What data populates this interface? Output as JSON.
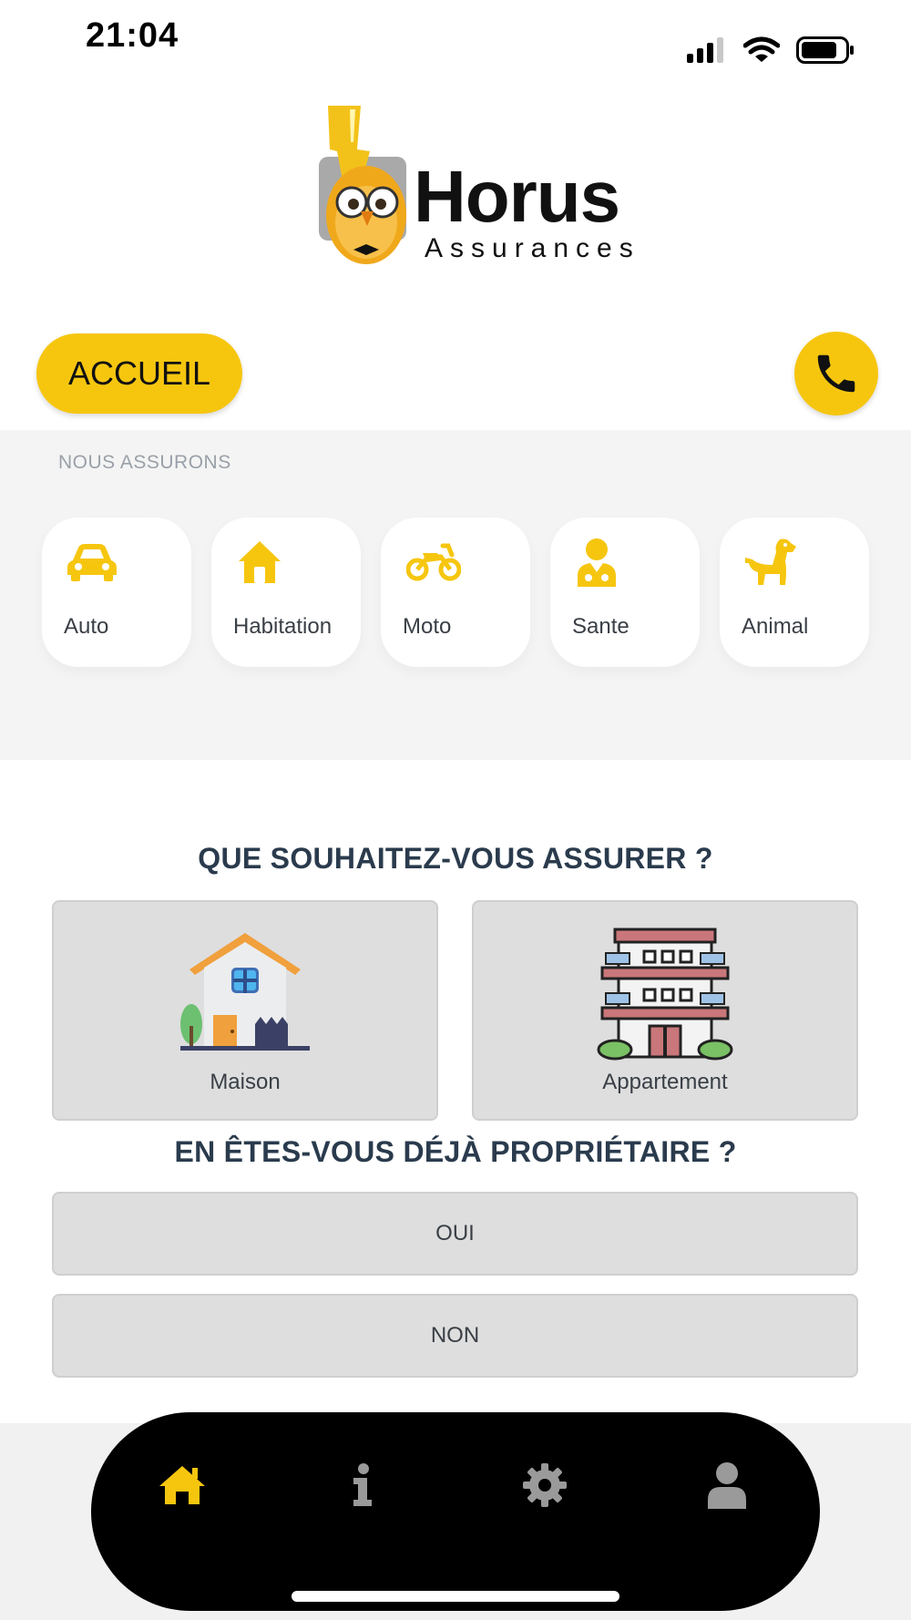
{
  "status_bar": {
    "time": "21:04"
  },
  "logo": {
    "title": "Horus",
    "subtitle": "Assurances"
  },
  "header": {
    "home_button_label": "ACCUEIL",
    "phone_button_icon": "phone-icon"
  },
  "categories": {
    "heading": "NOUS ASSURONS",
    "items": [
      {
        "label": "Auto",
        "icon": "car-icon"
      },
      {
        "label": "Habitation",
        "icon": "house-icon"
      },
      {
        "label": "Moto",
        "icon": "motorcycle-icon"
      },
      {
        "label": "Sante",
        "icon": "doctor-icon"
      },
      {
        "label": "Animal",
        "icon": "dog-icon"
      }
    ]
  },
  "question_1": {
    "title": "QUE SOUHAITEZ-VOUS ASSURER ?",
    "options": [
      {
        "label": "Maison",
        "icon": "house-illustration"
      },
      {
        "label": "Appartement",
        "icon": "apartment-building-illustration"
      }
    ]
  },
  "question_2": {
    "title": "EN ÊTES-VOUS DÉJÀ PROPRIÉTAIRE ?",
    "options": [
      {
        "label": "OUI"
      },
      {
        "label": "NON"
      }
    ]
  },
  "nav": {
    "items": [
      {
        "icon": "home-icon",
        "active": true
      },
      {
        "icon": "info-icon",
        "active": false
      },
      {
        "icon": "gear-icon",
        "active": false
      },
      {
        "icon": "user-icon",
        "active": false
      }
    ]
  },
  "colors": {
    "accent": "#f6c60f",
    "heading": "#2a3b4d",
    "nav_background": "#000000",
    "nav_inactive": "#9a9a9a"
  }
}
